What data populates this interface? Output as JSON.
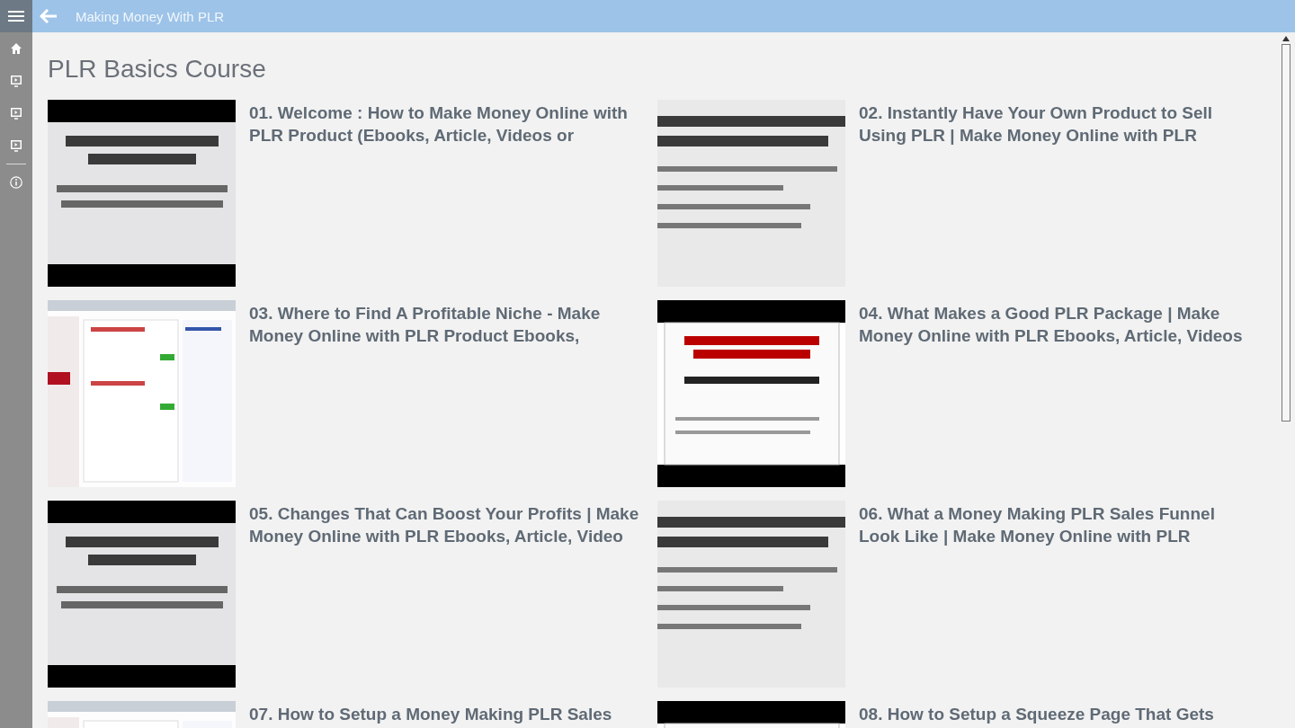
{
  "app_bar": {
    "title": "Making Money With PLR"
  },
  "page_title": "PLR Basics Course",
  "videos": [
    {
      "title": "01. Welcome : How to Make Money Online with PLR Product (Ebooks, Article, Videos or"
    },
    {
      "title": "02. Instantly Have Your Own Product to Sell Using PLR | Make Money Online with PLR"
    },
    {
      "title": "03. Where to Find A Profitable Niche - Make Money Online with PLR Product Ebooks,"
    },
    {
      "title": "04. What Makes a Good PLR Package | Make Money Online with PLR Ebooks, Article, Videos"
    },
    {
      "title": "05. Changes That Can Boost Your Profits | Make Money Online with PLR Ebooks, Article, Video"
    },
    {
      "title": "06. What a Money Making PLR Sales Funnel Look Like | Make Money Online with PLR"
    },
    {
      "title": "07. How to Setup a Money Making PLR Sales"
    },
    {
      "title": "08. How to Setup a Squeeze Page That Gets"
    }
  ]
}
